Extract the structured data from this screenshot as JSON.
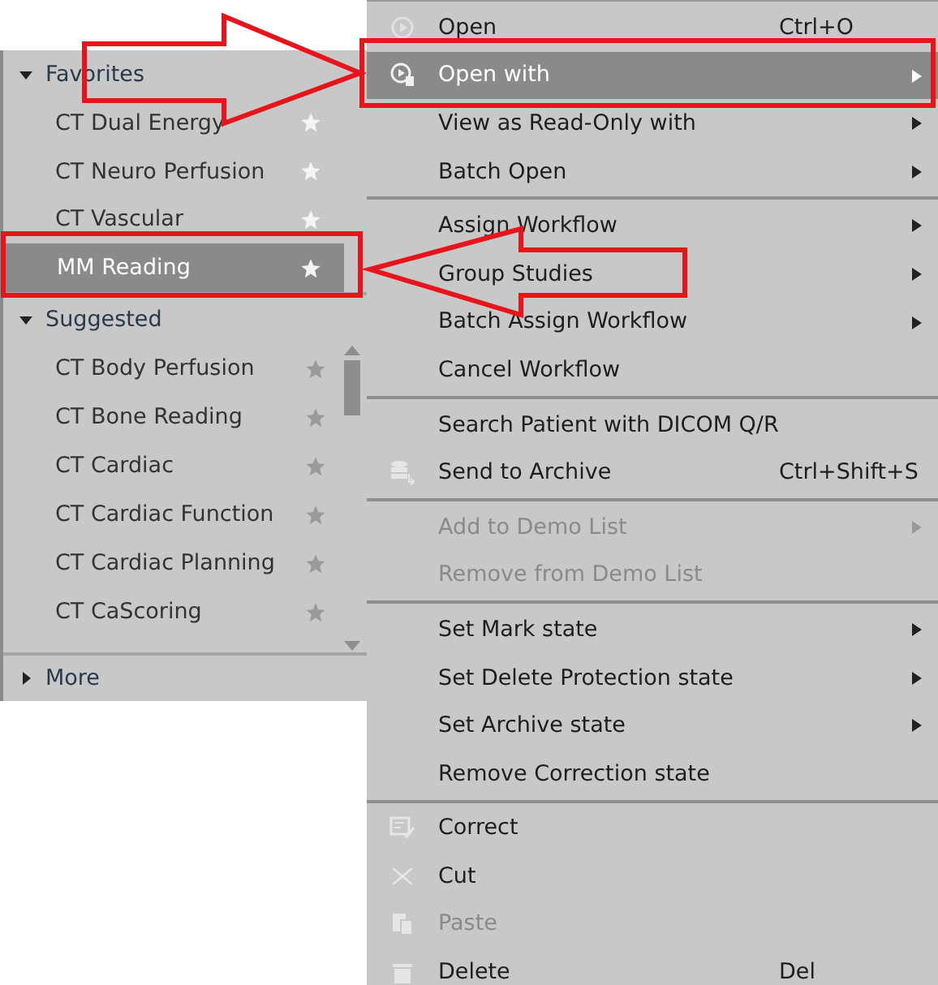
{
  "workflow_panel": {
    "sections": [
      {
        "title": "Favorites",
        "expanded": true,
        "items": [
          {
            "label": "CT Dual Energy",
            "starred": true,
            "selected": false
          },
          {
            "label": "CT Neuro Perfusion",
            "starred": true,
            "selected": false
          },
          {
            "label": "CT Vascular",
            "starred": true,
            "selected": false
          },
          {
            "label": "MM Reading",
            "starred": true,
            "selected": true
          }
        ]
      },
      {
        "title": "Suggested",
        "expanded": true,
        "items": [
          {
            "label": "CT Body Perfusion",
            "starred": false,
            "selected": false
          },
          {
            "label": "CT Bone Reading",
            "starred": false,
            "selected": false
          },
          {
            "label": "CT Cardiac",
            "starred": false,
            "selected": false
          },
          {
            "label": "CT Cardiac Function",
            "starred": false,
            "selected": false
          },
          {
            "label": "CT Cardiac Planning",
            "starred": false,
            "selected": false
          },
          {
            "label": "CT CaScoring",
            "starred": false,
            "selected": false
          }
        ]
      }
    ],
    "more": {
      "label": "More",
      "expanded": false
    }
  },
  "context_menu": {
    "groups": [
      [
        {
          "label": "Open",
          "shortcut": "Ctrl+O",
          "kind": "play",
          "submenu": false,
          "disabled": false,
          "selected": false
        },
        {
          "label": "Open with",
          "kind": "play-doc",
          "submenu": true,
          "disabled": false,
          "selected": true
        },
        {
          "label": "View as Read-Only with",
          "submenu": true,
          "disabled": false,
          "selected": false
        },
        {
          "label": "Batch Open",
          "submenu": true,
          "disabled": false,
          "selected": false
        }
      ],
      [
        {
          "label": "Assign Workflow",
          "submenu": true,
          "disabled": false,
          "selected": false
        },
        {
          "label": "Group Studies",
          "submenu": true,
          "disabled": false,
          "selected": false
        },
        {
          "label": "Batch Assign Workflow",
          "submenu": true,
          "disabled": false,
          "selected": false
        },
        {
          "label": "Cancel Workflow",
          "submenu": false,
          "disabled": false,
          "selected": false
        }
      ],
      [
        {
          "label": "Search Patient with DICOM Q/R",
          "submenu": false,
          "disabled": false,
          "selected": false
        },
        {
          "label": "Send to Archive",
          "shortcut": "Ctrl+Shift+S",
          "kind": "archive",
          "submenu": false,
          "disabled": false,
          "selected": false
        }
      ],
      [
        {
          "label": "Add to Demo List",
          "submenu": true,
          "disabled": true,
          "selected": false
        },
        {
          "label": "Remove from Demo List",
          "submenu": false,
          "disabled": true,
          "selected": false
        }
      ],
      [
        {
          "label": "Set Mark state",
          "submenu": true,
          "disabled": false,
          "selected": false
        },
        {
          "label": "Set Delete Protection state",
          "submenu": true,
          "disabled": false,
          "selected": false
        },
        {
          "label": "Set Archive state",
          "submenu": true,
          "disabled": false,
          "selected": false
        },
        {
          "label": "Remove Correction state",
          "submenu": false,
          "disabled": false,
          "selected": false
        }
      ],
      [
        {
          "label": "Correct",
          "kind": "edit",
          "submenu": false,
          "disabled": false,
          "selected": false
        },
        {
          "label": "Cut",
          "kind": "scissors",
          "submenu": false,
          "disabled": false,
          "selected": false
        },
        {
          "label": "Paste",
          "kind": "paste",
          "submenu": false,
          "disabled": true,
          "selected": false
        },
        {
          "label": "Delete",
          "shortcut": "Del",
          "kind": "trash",
          "submenu": false,
          "disabled": false,
          "selected": false
        }
      ]
    ]
  }
}
